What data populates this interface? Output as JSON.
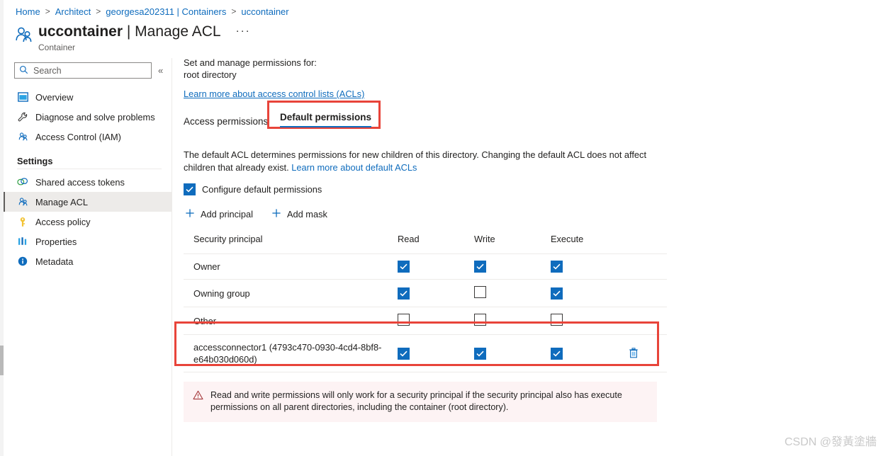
{
  "breadcrumb": {
    "items": [
      {
        "label": "Home"
      },
      {
        "label": "Architect"
      },
      {
        "label": "georgesa202311 | Containers"
      },
      {
        "label": "uccontainer"
      }
    ],
    "separator": ">"
  },
  "header": {
    "title_resource": "uccontainer",
    "title_separator": " | ",
    "title_page": "Manage ACL",
    "ellipsis": "···",
    "subtitle": "Container"
  },
  "sidebar": {
    "search": {
      "placeholder": "Search",
      "value": "",
      "icon": "search-icon"
    },
    "collapse_icon": "«",
    "items": [
      {
        "label": "Overview",
        "icon": "overview-icon",
        "selected": false
      },
      {
        "label": "Diagnose and solve problems",
        "icon": "wrench-icon",
        "selected": false
      },
      {
        "label": "Access Control (IAM)",
        "icon": "people-icon",
        "selected": false
      }
    ],
    "group_title": "Settings",
    "settings_items": [
      {
        "label": "Shared access tokens",
        "icon": "token-icon",
        "selected": false
      },
      {
        "label": "Manage ACL",
        "icon": "people-icon",
        "selected": true
      },
      {
        "label": "Access policy",
        "icon": "key-icon",
        "selected": false
      },
      {
        "label": "Properties",
        "icon": "properties-icon",
        "selected": false
      },
      {
        "label": "Metadata",
        "icon": "info-icon",
        "selected": false
      }
    ]
  },
  "main": {
    "set_manage_label": "Set and manage permissions for:",
    "target_directory": "root directory",
    "acl_learn_link": "Learn more about access control lists (ACLs)",
    "tabs": [
      {
        "label": "Access permissions",
        "active": false
      },
      {
        "label": "Default permissions",
        "active": true,
        "highlighted": true
      }
    ],
    "description_part1": "The default ACL determines permissions for new children of this directory. Changing the default ACL does not affect children that already exist. ",
    "description_link": "Learn more about default ACLs",
    "configure_checkbox": {
      "label": "Configure default permissions",
      "checked": true
    },
    "commands": [
      {
        "label": "Add principal",
        "icon": "plus-icon"
      },
      {
        "label": "Add mask",
        "icon": "plus-icon"
      }
    ],
    "table": {
      "columns": [
        "Security principal",
        "Read",
        "Write",
        "Execute",
        ""
      ],
      "rows": [
        {
          "principal": "Owner",
          "read": true,
          "write": true,
          "execute": true,
          "deletable": false,
          "highlighted": false
        },
        {
          "principal": "Owning group",
          "read": true,
          "write": false,
          "execute": true,
          "deletable": false,
          "highlighted": false
        },
        {
          "principal": "Other",
          "read": false,
          "write": false,
          "execute": false,
          "deletable": false,
          "highlighted": false
        },
        {
          "principal": "accessconnector1 (4793c470-0930-4cd4-8bf8-e64b030d060d)",
          "read": true,
          "write": true,
          "execute": true,
          "deletable": true,
          "delete_icon": "trash-icon",
          "highlighted": true
        }
      ]
    },
    "warning": {
      "icon": "warning-triangle-icon",
      "text": "Read and write permissions will only work for a security principal if the security principal also has execute permissions on all parent directories, including the container (root directory)."
    }
  },
  "watermark": "CSDN @發黃塗牆",
  "colors": {
    "accent_blue": "#0f6cbd",
    "link_blue": "#0f6cbd",
    "annotation_red": "#e8443a",
    "warning_bg": "#fdf3f4",
    "selected_nav_bg": "#edebe9"
  }
}
